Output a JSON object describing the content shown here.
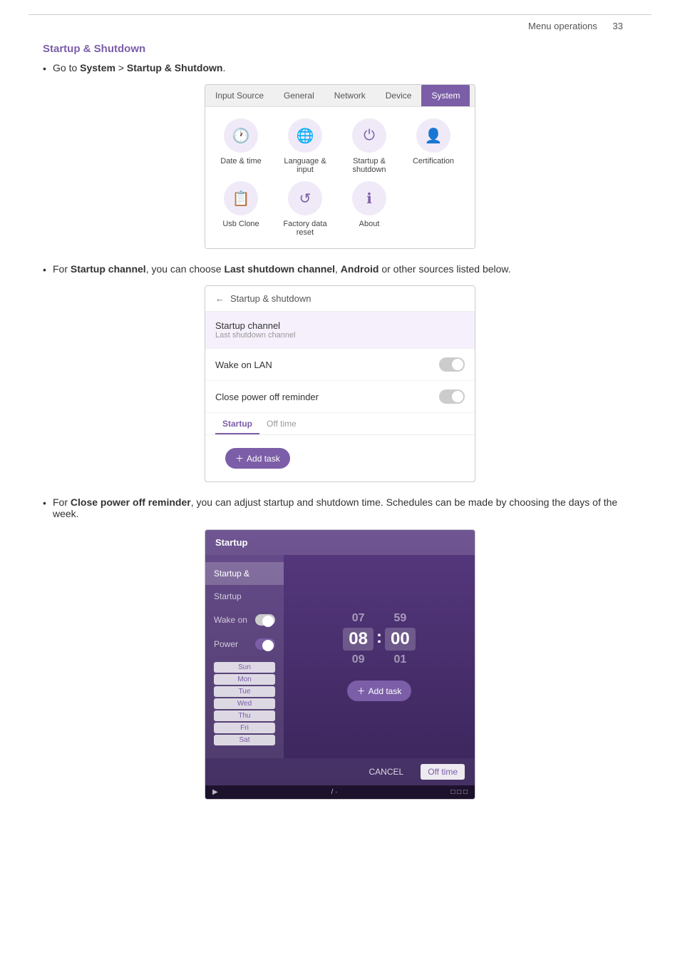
{
  "page": {
    "header": {
      "section": "Menu operations",
      "page_number": "33"
    },
    "section_title": "Startup & Shutdown",
    "bullet1": {
      "text_before": "Go to ",
      "bold1": "System",
      "text_mid": " > ",
      "bold2": "Startup & Shutdown",
      "text_after": "."
    },
    "bullet2": {
      "text_before": "For ",
      "bold1": "Startup channel",
      "text_mid": ", you can choose ",
      "bold2": "Last shutdown channel",
      "text_mid2": ", ",
      "bold3": "Android",
      "text_after": " or other sources listed below."
    },
    "bullet3": {
      "text_before": "For ",
      "bold1": "Close power off reminder",
      "text_after": ", you can adjust startup and shutdown time. Schedules can be made by choosing the days of the week."
    },
    "system_menu": {
      "tabs": [
        "Input Source",
        "General",
        "Network",
        "Device",
        "System"
      ],
      "active_tab": "System",
      "icons": [
        {
          "label": "Date & time",
          "icon": "🕐"
        },
        {
          "label": "Language & input",
          "icon": "🌐"
        },
        {
          "label": "Startup & shutdown",
          "icon": "⏻"
        },
        {
          "label": "Certification",
          "icon": "👤"
        },
        {
          "label": "Usb Clone",
          "icon": "📋"
        },
        {
          "label": "Factory data reset",
          "icon": "↺"
        },
        {
          "label": "About",
          "icon": "ℹ"
        }
      ]
    },
    "startup_panel": {
      "back_label": "Startup & shutdown",
      "rows": [
        {
          "label": "Startup channel",
          "sub": "Last shutdown channel",
          "type": "nav",
          "highlighted": true
        },
        {
          "label": "Wake on LAN",
          "type": "toggle",
          "state": "off"
        },
        {
          "label": "Close power off reminder",
          "type": "toggle",
          "state": "off"
        }
      ],
      "tabs": [
        "Startup",
        "Off time"
      ],
      "active_tab": "Startup",
      "add_task_label": "Add task"
    },
    "time_picker": {
      "title": "Startup",
      "left_panel": {
        "rows": [
          {
            "label": "Startup &",
            "type": "section"
          },
          {
            "label": "Startup",
            "sub": "",
            "type": "row"
          },
          {
            "label": "Wake on",
            "type": "toggle_row"
          },
          {
            "label": "Power",
            "type": "toggle_row"
          }
        ]
      },
      "days": [
        "Sun",
        "Mon",
        "Tue",
        "Wed",
        "Thu",
        "Fri",
        "Sat"
      ],
      "hours": [
        "07",
        "08",
        "09"
      ],
      "minutes": [
        "59",
        "00",
        "01"
      ],
      "selected_hour": "08",
      "selected_minute": "00",
      "actions": [
        "CANCEL",
        "Off time"
      ],
      "add_task": "Add task"
    }
  }
}
